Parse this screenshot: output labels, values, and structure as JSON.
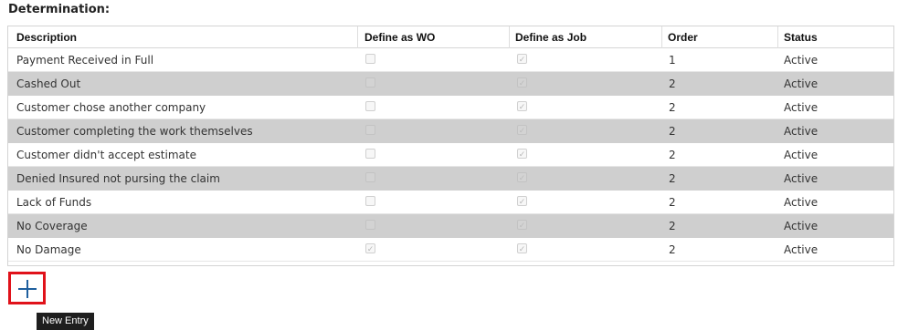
{
  "section_title": "Determination:",
  "table": {
    "columns": {
      "description": "Description",
      "define_wo": "Define as WO",
      "define_job": "Define as Job",
      "order": "Order",
      "status": "Status"
    },
    "rows": [
      {
        "description": "Payment Received in Full",
        "wo": false,
        "job": true,
        "order": "1",
        "status": "Active"
      },
      {
        "description": "Cashed Out",
        "wo": false,
        "job": true,
        "order": "2",
        "status": "Active"
      },
      {
        "description": "Customer chose another company",
        "wo": false,
        "job": true,
        "order": "2",
        "status": "Active"
      },
      {
        "description": "Customer completing the work themselves",
        "wo": false,
        "job": true,
        "order": "2",
        "status": "Active"
      },
      {
        "description": "Customer didn't accept estimate",
        "wo": false,
        "job": true,
        "order": "2",
        "status": "Active"
      },
      {
        "description": "Denied Insured not pursing the claim",
        "wo": false,
        "job": true,
        "order": "2",
        "status": "Active"
      },
      {
        "description": "Lack of Funds",
        "wo": false,
        "job": true,
        "order": "2",
        "status": "Active"
      },
      {
        "description": "No Coverage",
        "wo": false,
        "job": true,
        "order": "2",
        "status": "Active"
      },
      {
        "description": "No Damage",
        "wo": true,
        "job": true,
        "order": "2",
        "status": "Active"
      }
    ]
  },
  "add_button": {
    "icon": "plus-icon",
    "tooltip": "New Entry",
    "highlight_color": "#e0121a",
    "icon_color": "#1f5f9e"
  }
}
